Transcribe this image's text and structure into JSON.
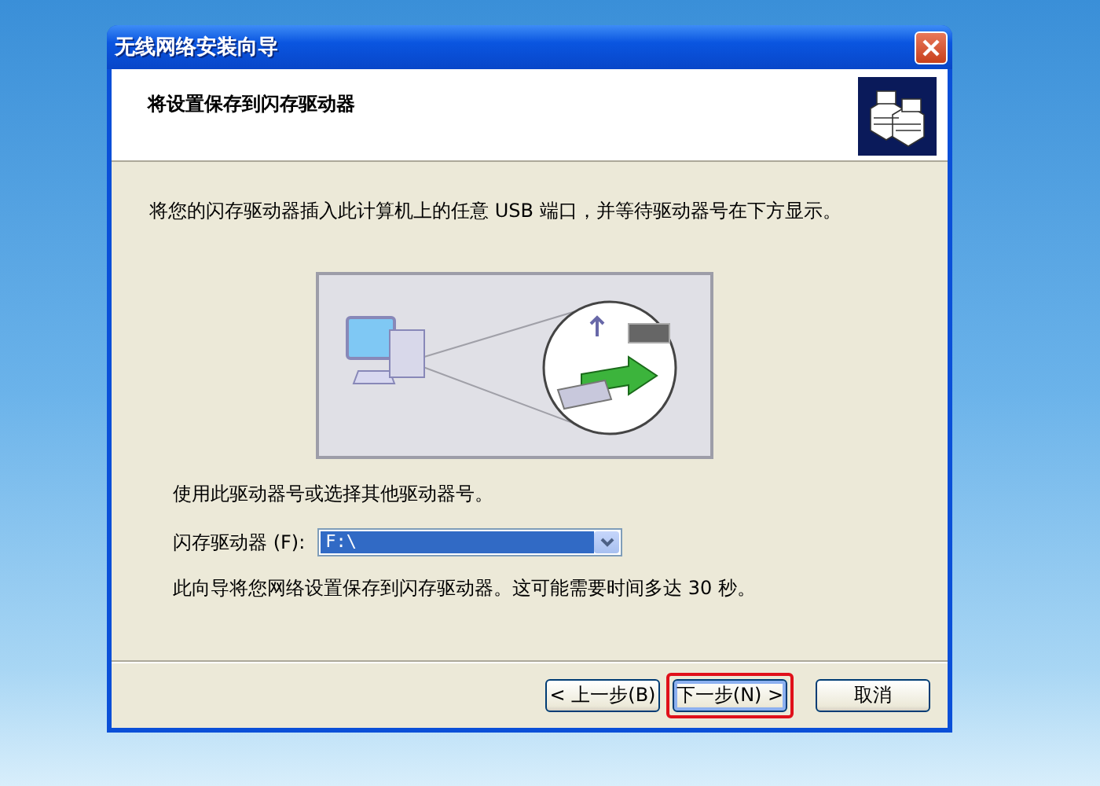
{
  "window": {
    "title": "无线网络安装向导"
  },
  "header": {
    "title": "将设置保存到闪存驱动器"
  },
  "instruction": "将您的闪存驱动器插入此计算机上的任意 USB 端口，并等待驱动器号在下方显示。",
  "hint": "使用此驱动器号或选择其他驱动器号。",
  "drive_field": {
    "label": "闪存驱动器 (F):",
    "value": "F:\\",
    "selected": true
  },
  "note": "此向导将您网络设置保存到闪存驱动器。这可能需要时间多达 30 秒。",
  "buttons": [
    {
      "label": "< 上一步(B)",
      "kind": "back",
      "default": false,
      "highlighted": false
    },
    {
      "label": "下一步(N) >",
      "kind": "next",
      "default": true,
      "highlighted": true
    },
    {
      "label": "取消",
      "kind": "cancel",
      "default": false,
      "highlighted": false
    }
  ]
}
